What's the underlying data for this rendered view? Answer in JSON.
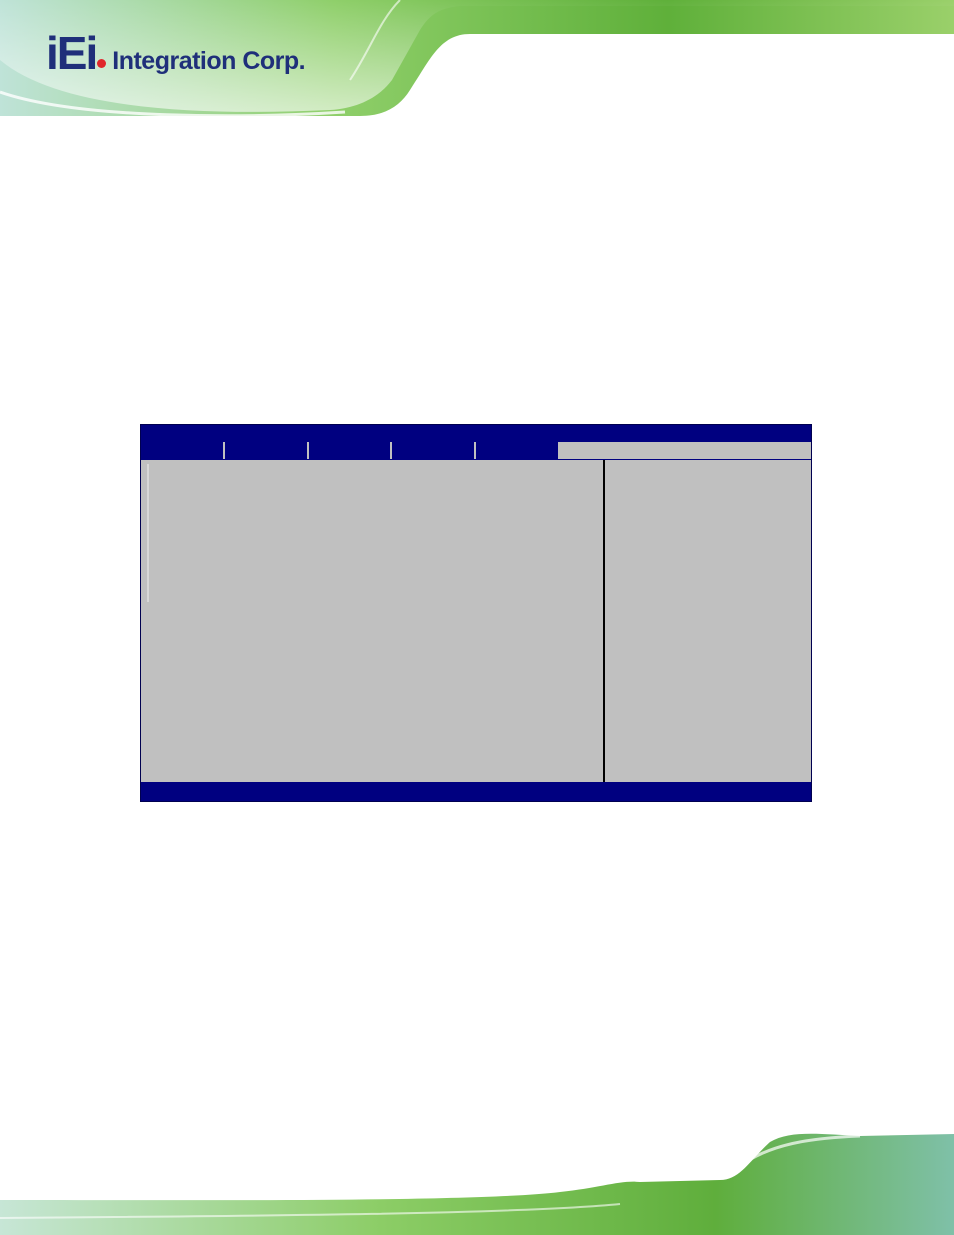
{
  "brand": {
    "logo_mark": "iEi",
    "logo_word": "Integration Corp.",
    "primary_color": "#1f2f7a",
    "accent_color": "#e0262b",
    "banner_color": "#6db33f"
  },
  "bios": {
    "title": "",
    "tabs": [
      "",
      "",
      "",
      "",
      "",
      ""
    ],
    "active_tab_index": 5,
    "status_text": "",
    "colors": {
      "bar": "#000080",
      "panel": "#c0c0c0"
    }
  }
}
